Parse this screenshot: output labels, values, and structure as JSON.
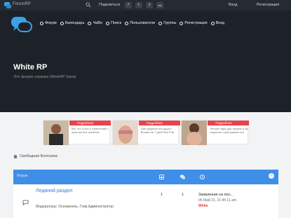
{
  "topbar": {
    "forum_name": "ForumRP",
    "share_label": "Поделиться",
    "social": [
      "f",
      "t",
      "v",
      "rss"
    ],
    "login": "Вход",
    "register": "Регистрация"
  },
  "nav": {
    "items": [
      {
        "label": "Форум",
        "icon": "comment-icon"
      },
      {
        "label": "Календарь",
        "icon": "calendar-icon"
      },
      {
        "label": "ЧаВо",
        "icon": "question-icon"
      },
      {
        "label": "Поиск",
        "icon": "search-icon"
      },
      {
        "label": "Пользователи",
        "icon": "users-icon"
      },
      {
        "label": "Группы",
        "icon": "group-icon"
      },
      {
        "label": "Регистрация",
        "icon": "register-icon"
      },
      {
        "label": "Вход",
        "icon": "login-icon"
      }
    ]
  },
  "hero": {
    "title": "White RP",
    "subtitle": "Это форум сервера WhiteRP Samp"
  },
  "ads": [
    {
      "title": "Подробнее",
      "text": "Вот что стоит у изменений с пунктом без проблем"
    },
    {
      "title": "Подробнее",
      "text": "Уже надоели эти дыры? Вставь на 7 дней без Ров"
    },
    {
      "title": "Подробнее",
      "text": "Летняя пара для начала и за отдыхом с растущими пос"
    }
  ],
  "breadcrumb": {
    "label": "Свободная Болталка"
  },
  "panel": {
    "head_label": "Форум",
    "forum_title": "Ледяной раздел",
    "moderators": "Модераторы: Основатель, Глав.Администратор",
    "topics": "1",
    "posts": "1",
    "last_post_title": "Заявления на пос...",
    "last_post_date": "05 Май 21, 21:45:11 am",
    "last_post_user": "White"
  },
  "colors": {
    "topbar": "#262b32",
    "hero": "#1d2229",
    "panel_head": "#3f8ee8",
    "ad_red": "#e8434b",
    "link": "#2f7fd9"
  }
}
